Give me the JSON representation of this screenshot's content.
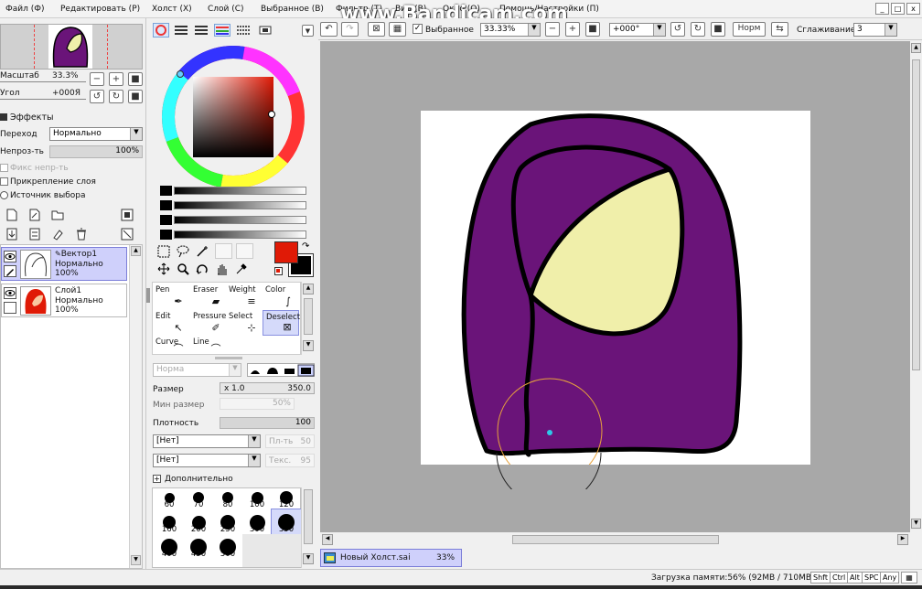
{
  "watermark": "www.Bandicam.com",
  "menu": [
    "Файл (Ф)",
    "Редактировать (Р)",
    "Холст (Х)",
    "Слой (С)",
    "Выбранное (В)",
    "Фильтр (Т)",
    "Вид (В)",
    "Окно (О)",
    "Помощь/Настройки (П)"
  ],
  "window_buttons": [
    "_",
    "□",
    "x"
  ],
  "navigator": {
    "zoom_label": "Масштаб",
    "zoom_value": "33.3%",
    "angle_label": "Угол",
    "angle_value": "+000Я"
  },
  "layer_props": {
    "effects_label": "Эффекты",
    "blend_label": "Переход",
    "blend_value": "Нормально",
    "opacity_label": "Непроз-ть",
    "opacity_value": "100%",
    "lock_opacity_label": "Фикс непр-ть",
    "clip_label": "Прикрепление слоя",
    "selection_source_label": "Источник выбора"
  },
  "layers": [
    {
      "name": "Вектор1",
      "mode": "Нормально",
      "opacity": "100%",
      "selected": true
    },
    {
      "name": "Слой1",
      "mode": "Нормально",
      "opacity": "100%",
      "selected": false
    }
  ],
  "tools": [
    {
      "label": "Pen",
      "icon": "pen-icon"
    },
    {
      "label": "Eraser",
      "icon": "eraser-icon"
    },
    {
      "label": "Weight",
      "icon": "weight-icon"
    },
    {
      "label": "Color",
      "icon": "color-curve-icon"
    },
    {
      "label": "Edit",
      "icon": "edit-cursor-icon"
    },
    {
      "label": "Pressure",
      "icon": "pressure-icon"
    },
    {
      "label": "Select",
      "icon": "select-icon"
    },
    {
      "label": "Deselect",
      "icon": "deselect-icon"
    },
    {
      "label": "Curve",
      "icon": "curve-icon"
    },
    {
      "label": "Line",
      "icon": "line-icon"
    }
  ],
  "brush": {
    "mode_value": "Норма",
    "size_label": "Размер",
    "size_mult": "x 1.0",
    "size_value": "350.0",
    "min_size_label": "Мин размер",
    "min_size_value": "50%",
    "density_label": "Плотность",
    "density_value": "100",
    "texture1_value": "[Нет]",
    "texture1_extra_label": "Пл-ть",
    "texture1_extra_value": "50",
    "texture2_value": "[Нет]",
    "texture2_extra_label": "Текс.",
    "texture2_extra_value": "95",
    "advanced_label": "Дополнительно",
    "presets": [
      {
        "label": "60",
        "size": 0.6
      },
      {
        "label": "70",
        "size": 0.64
      },
      {
        "label": "80",
        "size": 0.68
      },
      {
        "label": "100",
        "size": 0.72
      },
      {
        "label": "120",
        "size": 0.75
      },
      {
        "label": "160",
        "size": 0.8
      },
      {
        "label": "200",
        "size": 0.85
      },
      {
        "label": "250",
        "size": 0.9
      },
      {
        "label": "300",
        "size": 0.95
      },
      {
        "label": "350",
        "size": 1.0,
        "selected": true
      },
      {
        "label": "400",
        "size": 1.0
      },
      {
        "label": "450",
        "size": 1.0
      },
      {
        "label": "500",
        "size": 1.0
      }
    ]
  },
  "colors": {
    "primary": "#e01a06",
    "secondary": "#000000",
    "panel_bg": "#f0f0f0",
    "workspace_bg": "#a8a8a8",
    "hood_purple": "#6a1479",
    "face_cream": "#f0efaa"
  },
  "toolbar": {
    "selection_checkbox_label": "Выбранное",
    "zoom_value": "33.33%",
    "angle_value": "+000°",
    "mode_value": "Норм",
    "smoothing_label": "Сглаживание",
    "smoothing_value": "3"
  },
  "document_tab": {
    "name": "Новый Холст.sai",
    "zoom": "33%"
  },
  "status": {
    "memory": "Загрузка памяти:56% (92MB / 710MB)",
    "keys": [
      "Shft",
      "Ctrl",
      "Alt",
      "SPC",
      "Any"
    ]
  }
}
